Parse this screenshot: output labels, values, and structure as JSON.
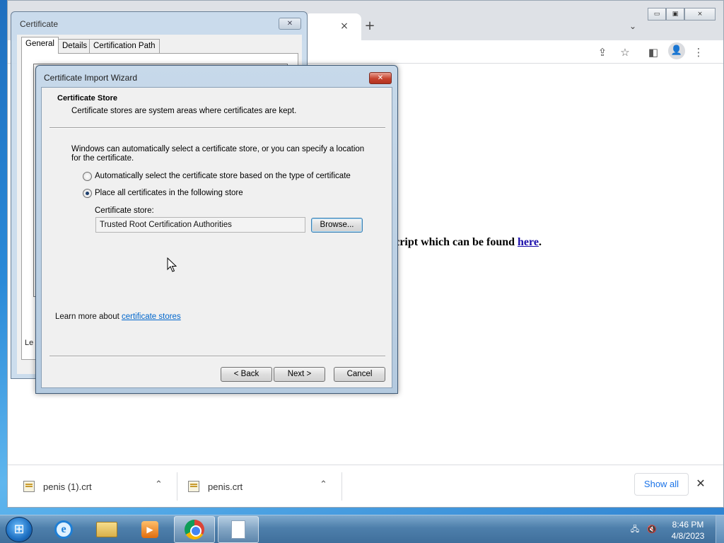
{
  "browser": {
    "tab_close_icon": "×",
    "new_tab_icon": "+",
    "tab_search_icon": "⌄",
    "window_controls": {
      "minimize": "▭",
      "restore": "▣",
      "close": "⨯"
    },
    "toolbar_icons": {
      "share": "⇪",
      "bookmark": "☆",
      "side_panel": "◧",
      "profile": "👤",
      "menu": "⋮"
    },
    "page": {
      "text_before_link": "script which can be found ",
      "link_text": "here",
      "text_after_link": "."
    },
    "colors": {
      "link": "#1a0dab",
      "shelf_button_text": "#1a73e8"
    }
  },
  "downloads": {
    "items": [
      {
        "name": "penis (1).crt",
        "chevron": "⌃"
      },
      {
        "name": "penis.crt",
        "chevron": "⌃"
      }
    ],
    "show_all_label": "Show all",
    "close_icon": "✕"
  },
  "certificate_dialog": {
    "title": "Certificate",
    "close_icon": "✕",
    "tabs": [
      "General",
      "Details",
      "Certification Path"
    ],
    "active_tab": "General",
    "learn_fragment": "Le"
  },
  "wizard": {
    "title": "Certificate Import Wizard",
    "close_icon": "✕",
    "header_title": "Certificate Store",
    "header_description": "Certificate stores are system areas where certificates are kept.",
    "intro": "Windows can automatically select a certificate store, or you can specify a location for the certificate.",
    "options": [
      {
        "label": "Automatically select the certificate store based on the type of certificate",
        "checked": false
      },
      {
        "label": "Place all certificates in the following store",
        "checked": true
      }
    ],
    "store_label": "Certificate store:",
    "store_value": "Trusted Root Certification Authorities",
    "browse_label": "Browse...",
    "learn_more_prefix": "Learn more about ",
    "learn_more_link": "certificate stores",
    "back_label": "< Back",
    "next_label": "Next >",
    "cancel_label": "Cancel"
  },
  "taskbar": {
    "start_icon": "⊞",
    "apps": [
      "internet-explorer",
      "windows-explorer",
      "media-player",
      "google-chrome",
      "document"
    ],
    "active_app": "google-chrome",
    "tray": {
      "network_icon": "🖧",
      "volume_icon": "🔇"
    },
    "time": "8:46 PM",
    "date": "4/8/2023"
  }
}
